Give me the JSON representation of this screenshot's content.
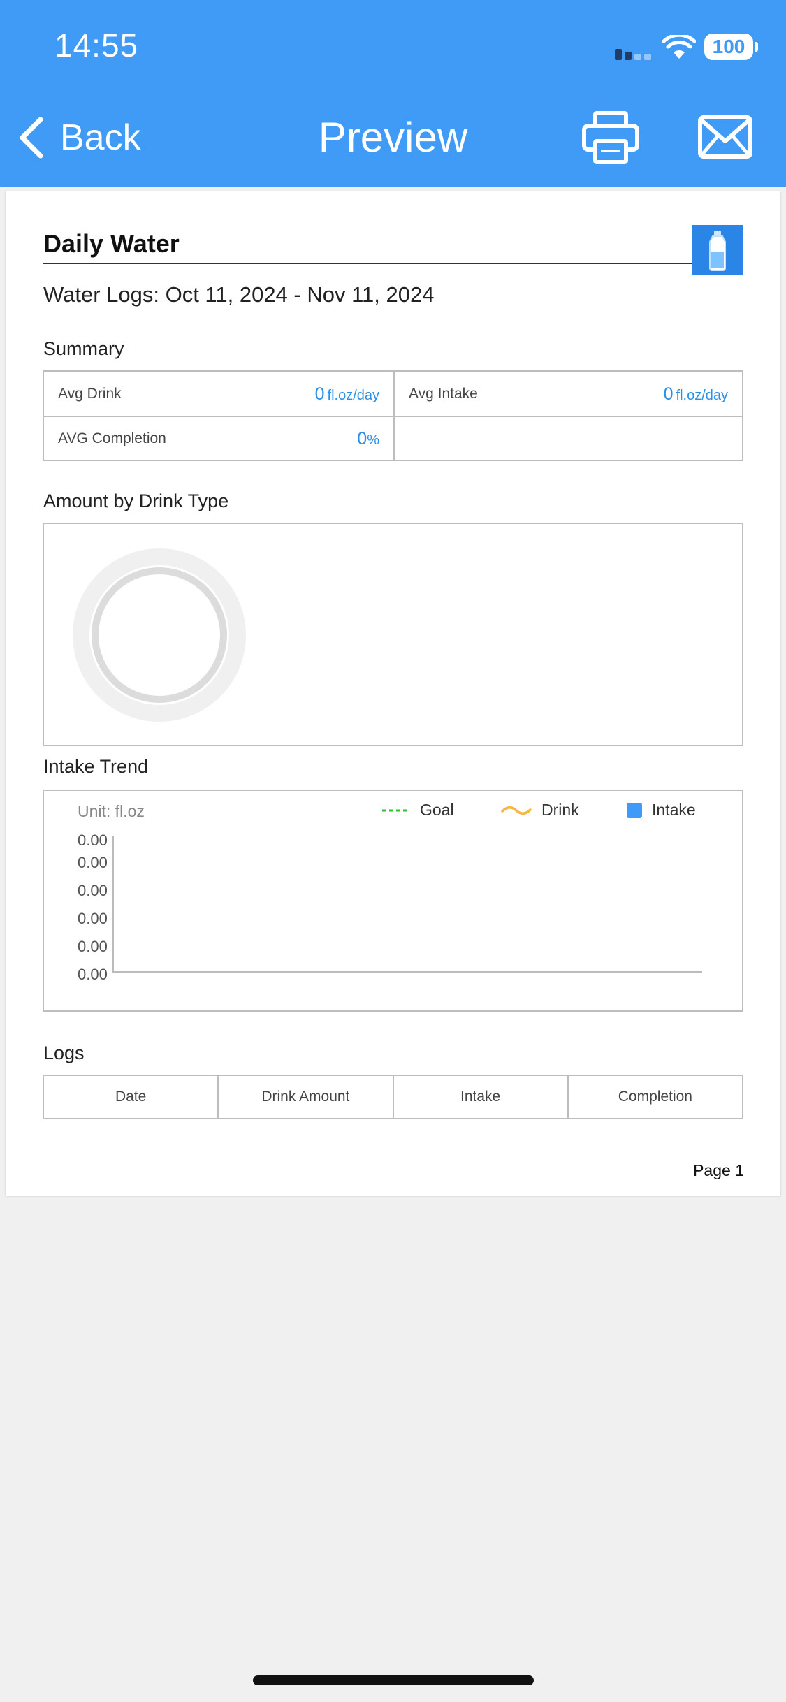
{
  "status_bar": {
    "time": "14:55",
    "battery": "100"
  },
  "nav": {
    "back_label": "Back",
    "title": "Preview"
  },
  "document": {
    "title": "Daily Water",
    "date_range": "Water Logs: Oct 11, 2024 - Nov 11, 2024",
    "summary": {
      "section_title": "Summary",
      "avg_drink": {
        "label": "Avg Drink",
        "value": "0",
        "unit": "fl.oz/day"
      },
      "avg_intake": {
        "label": "Avg Intake",
        "value": "0",
        "unit": "fl.oz/day"
      },
      "avg_completion": {
        "label": "AVG Completion",
        "value": "0",
        "unit": "%"
      }
    },
    "drink_type": {
      "section_title": "Amount by Drink Type"
    },
    "intake_trend": {
      "section_title": "Intake Trend",
      "unit_label": "Unit: fl.oz",
      "legend": {
        "goal": "Goal",
        "drink": "Drink",
        "intake": "Intake"
      },
      "y_ticks": [
        "0.00",
        "0.00",
        "0.00",
        "0.00",
        "0.00",
        "0.00"
      ]
    },
    "logs": {
      "section_title": "Logs",
      "columns": [
        "Date",
        "Drink Amount",
        "Intake",
        "Completion"
      ]
    },
    "page_label": "Page 1"
  },
  "colors": {
    "header": "#3f9bf6",
    "value_blue": "#2c8fe6",
    "goal_green": "#2dc22d",
    "drink_yellow": "#f2b93b",
    "intake_blue": "#3f9bf6"
  }
}
